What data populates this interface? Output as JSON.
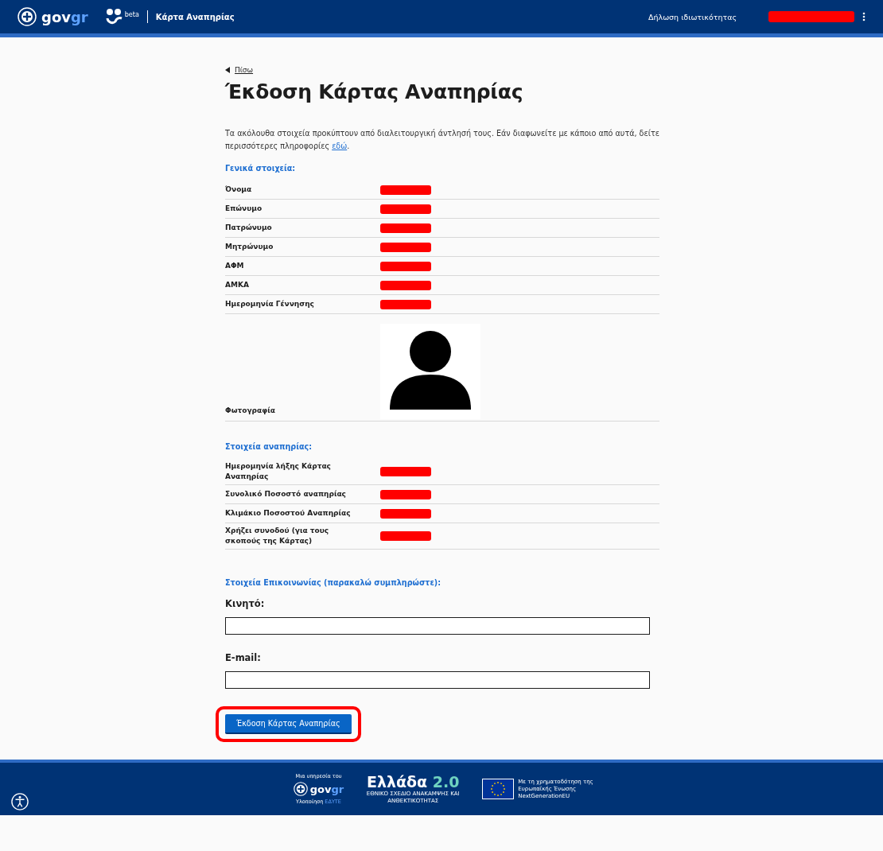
{
  "header": {
    "logo": [
      "gov",
      "gr"
    ],
    "beta_label": "beta",
    "service_title": "Κάρτα Αναπηρίας",
    "privacy_link": "Δήλωση ιδιωτικότητας",
    "user_redacted": true
  },
  "back_link": "Πίσω",
  "title": "Έκδοση Κάρτας Αναπηρίας",
  "intro": {
    "before": "Τα ακόλουθα στοιχεία προκύπτουν από διαλειτουργική άντλησή τους. Εάν διαφωνείτε με κάποιο από αυτά, δείτε περισσότερες πληροφορίες ",
    "link": "εδώ",
    "after": "."
  },
  "sections": [
    {
      "heading": "Γενικά στοιχεία:",
      "rows": [
        {
          "label": "Όνομα",
          "kind": "redacted"
        },
        {
          "label": "Επώνυμο",
          "kind": "redacted"
        },
        {
          "label": "Πατρώνυμο",
          "kind": "redacted"
        },
        {
          "label": "Μητρώνυμο",
          "kind": "redacted"
        },
        {
          "label": "ΑΦΜ",
          "kind": "redacted"
        },
        {
          "label": "ΑΜΚΑ",
          "kind": "redacted"
        },
        {
          "label": "Ημερομηνία Γέννησης",
          "kind": "redacted"
        },
        {
          "label": "Φωτογραφία",
          "kind": "photo"
        }
      ]
    },
    {
      "heading": "Στοιχεία αναπηρίας:",
      "rows": [
        {
          "label": "Ημερομηνία λήξης Κάρτας Αναπηρίας",
          "kind": "redacted"
        },
        {
          "label": "Συνολικό Ποσοστό αναπηρίας",
          "kind": "redacted"
        },
        {
          "label": "Κλιμάκιο Ποσοστού Αναπηρίας",
          "kind": "redacted"
        },
        {
          "label": "Χρήζει συνοδού (για τους σκοπούς της Κάρτας)",
          "kind": "redacted"
        }
      ]
    }
  ],
  "contact": {
    "heading": "Στοιχεία Επικοινωνίας (παρακαλώ συμπληρώστε):",
    "fields": [
      {
        "label": "Κινητό:"
      },
      {
        "label": "E-mail:"
      }
    ]
  },
  "submit_button": {
    "label": "Έκδοση Κάρτας Αναπηρίας",
    "highlighted": true
  },
  "footer": {
    "service_of": "Μια υπηρεσία του",
    "logo": [
      "gov",
      "gr"
    ],
    "implementation": [
      "Υλοποίηση",
      "ΕΔΥΤΕ"
    ],
    "greece_logo": [
      "Ελλάδα",
      "2.0"
    ],
    "plan": "ΕΘΝΙΚΟ ΣΧΕΔΙΟ ΑΝΑΚΑΜΨΗΣ ΚΑΙ ΑΝΘΕΚΤΙΚΟΤΗΤΑΣ",
    "eu_funding": "Με τη χρηματοδότηση της Ευρωπαϊκής Ένωσης",
    "eu_program": "NextGenerationEU"
  }
}
